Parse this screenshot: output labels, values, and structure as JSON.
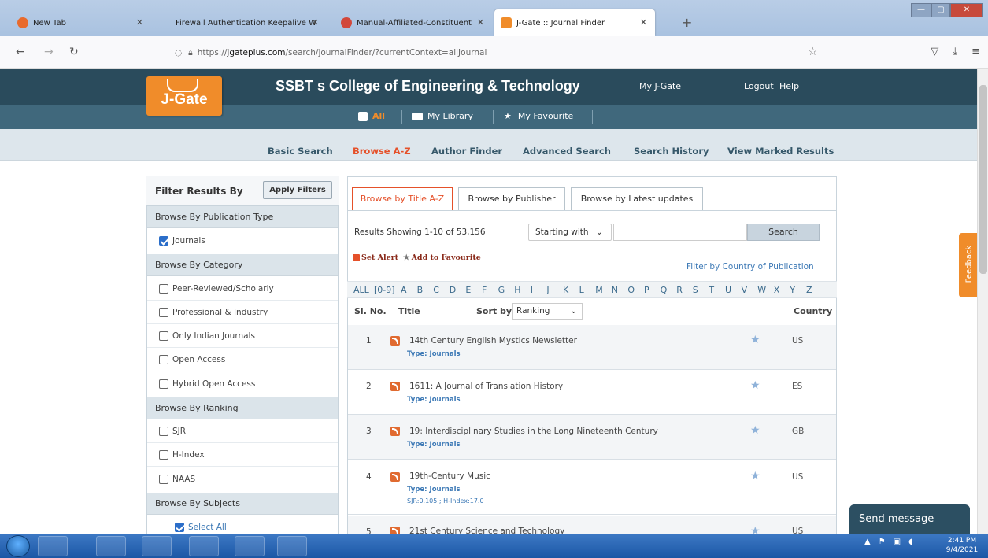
{
  "browser": {
    "tabs": [
      {
        "label": "New Tab",
        "close": "✕"
      },
      {
        "label": "Firewall Authentication Keepalive W",
        "close": "✕"
      },
      {
        "label": "Manual-Affiliated-Constituent",
        "close": "✕"
      },
      {
        "label": "J-Gate :: Journal Finder",
        "close": "✕"
      }
    ],
    "new_tab": "+",
    "url_prefix": "https://",
    "url_domain": "jgateplus.com",
    "url_path": "/search/journalFinder/?currentContext=allJournal",
    "window_buttons": {
      "minimize": "—",
      "maximize": "▢",
      "close": "✕"
    }
  },
  "site": {
    "logo_text": "J-Gate",
    "college": "SSBT s College of Engineering & Technology",
    "links": {
      "my_jgate": "My J-Gate",
      "logout": "Logout",
      "help": "Help"
    },
    "library_nav": [
      {
        "label": "All",
        "icon": "document-icon"
      },
      {
        "label": "My Library",
        "icon": "folder-icon"
      },
      {
        "label": "My Favourite",
        "icon": "star-icon"
      }
    ],
    "menu": [
      "Basic Search",
      "Browse A-Z",
      "Author Finder",
      "Advanced Search",
      "Search History",
      "View Marked Results"
    ]
  },
  "filters": {
    "title": "Filter Results By",
    "apply": "Apply Filters",
    "sections": [
      {
        "title": "Browse By Publication Type"
      },
      {
        "title": "Browse By Category"
      },
      {
        "title": "Browse By Ranking"
      },
      {
        "title": "Browse By Subjects"
      }
    ],
    "publication_type": [
      {
        "label": "Journals",
        "checked": true
      }
    ],
    "category": [
      {
        "label": "Peer-Reviewed/Scholarly",
        "checked": false
      },
      {
        "label": "Professional & Industry",
        "checked": false
      },
      {
        "label": "Only Indian Journals",
        "checked": false
      },
      {
        "label": "Open Access",
        "checked": false
      },
      {
        "label": "Hybrid Open Access",
        "checked": false
      }
    ],
    "ranking": [
      {
        "label": "SJR",
        "checked": false
      },
      {
        "label": "H-Index",
        "checked": false
      },
      {
        "label": "NAAS",
        "checked": false
      }
    ],
    "subjects": [
      {
        "label": "Select All",
        "checked": true
      }
    ]
  },
  "main": {
    "tabs": [
      "Browse by Title A-Z",
      "Browse by Publisher",
      "Browse by Latest updates"
    ],
    "results_text": "Results Showing 1-10 of 53,156",
    "starting_with": "Starting with",
    "search_label": "Search",
    "set_alert": "Set Alert",
    "add_fav": "Add to Favourite",
    "country_filter": "Filter by Country of Publication",
    "alphabet": [
      "ALL",
      "[0-9]",
      "A",
      "B",
      "C",
      "D",
      "E",
      "F",
      "G",
      "H",
      "I",
      "J",
      "K",
      "L",
      "M",
      "N",
      "O",
      "P",
      "Q",
      "R",
      "S",
      "T",
      "U",
      "V",
      "W",
      "X",
      "Y",
      "Z"
    ],
    "col_slno": "Sl. No.",
    "col_title": "Title",
    "sort_by": "Sort by",
    "sort_value": "Ranking",
    "col_country": "Country",
    "rows": [
      {
        "no": "1",
        "title": "14th Century English Mystics Newsletter",
        "type": "Type: Journals",
        "country": "US",
        "extra": ""
      },
      {
        "no": "2",
        "title": "1611: A Journal of Translation History",
        "type": "Type: Journals",
        "country": "ES",
        "extra": ""
      },
      {
        "no": "3",
        "title": "19: Interdisciplinary Studies in the Long Nineteenth Century",
        "type": "Type: Journals",
        "country": "GB",
        "extra": ""
      },
      {
        "no": "4",
        "title": "19th-Century Music",
        "type": "Type: Journals",
        "country": "US",
        "extra": "SJR:0.105 ; H-Index:17.0"
      },
      {
        "no": "5",
        "title": "21st Century Science and Technology",
        "type": "",
        "country": "US",
        "extra": ""
      }
    ]
  },
  "feedback": "Feedback",
  "send_message": "Send message",
  "clock": {
    "time": "2:41 PM",
    "date": "9/4/2021"
  }
}
